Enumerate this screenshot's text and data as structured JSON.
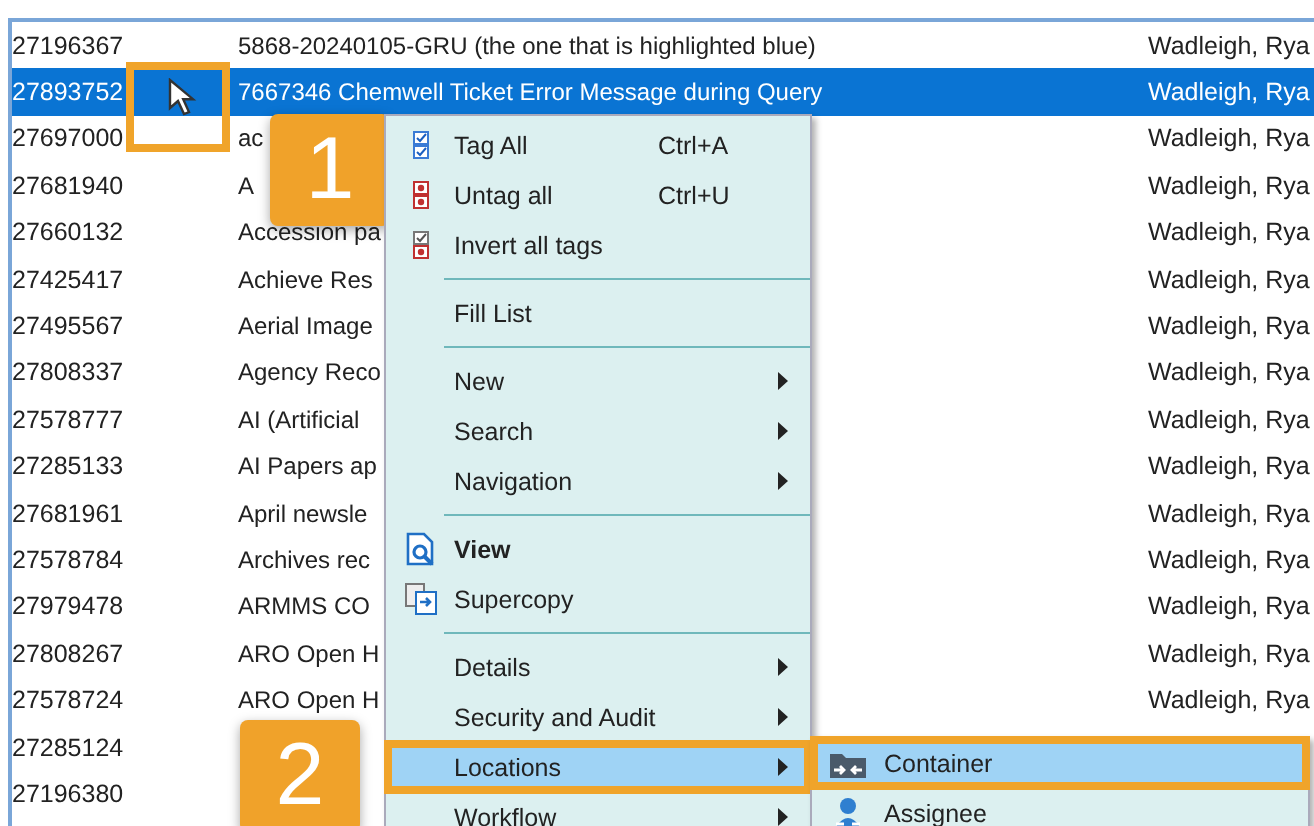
{
  "list": {
    "rows": [
      {
        "id": "27196367",
        "title": "5868-20240105-GRU (the one that is highlighted blue)",
        "owner": "Wadleigh, Rya",
        "selected": false
      },
      {
        "id": "27893752",
        "title": "7667346 Chemwell Ticket Error Message during Query",
        "owner": "Wadleigh, Rya",
        "selected": true
      },
      {
        "id": "27697000",
        "title": "ac",
        "owner": "Wadleigh, Rya",
        "selected": false
      },
      {
        "id": "27681940",
        "title": "A",
        "owner": "Wadleigh, Rya",
        "selected": false
      },
      {
        "id": "27660132",
        "title": "Accession pa",
        "owner": "Wadleigh, Rya",
        "selected": false
      },
      {
        "id": "27425417",
        "title": "Achieve Res",
        "owner": "Wadleigh, Rya",
        "selected": false
      },
      {
        "id": "27495567",
        "title": "Aerial Image",
        "owner": "Wadleigh, Rya",
        "selected": false
      },
      {
        "id": "27808337",
        "title": "Agency Reco",
        "owner": "Wadleigh, Rya",
        "selected": false
      },
      {
        "id": "27578777",
        "title": "AI (Artificial",
        "owner": "Wadleigh, Rya",
        "selected": false
      },
      {
        "id": "27285133",
        "title": "AI Papers ap",
        "owner": "Wadleigh, Rya",
        "selected": false
      },
      {
        "id": "27681961",
        "title": "April newsle",
        "owner": "Wadleigh, Rya",
        "selected": false
      },
      {
        "id": "27578784",
        "title": "Archives rec",
        "owner": "Wadleigh, Rya",
        "selected": false
      },
      {
        "id": "27979478",
        "title": "ARMMS CO",
        "owner": "Wadleigh, Rya",
        "selected": false
      },
      {
        "id": "27808267",
        "title": "ARO Open H",
        "owner": "Wadleigh, Rya",
        "selected": false
      },
      {
        "id": "27578724",
        "title": "ARO Open H",
        "owner": "Wadleigh, Rya",
        "selected": false
      },
      {
        "id": "27285124",
        "selected": false
      },
      {
        "id": "27196380",
        "selected": false
      }
    ]
  },
  "step_badges": [
    {
      "label": "1"
    },
    {
      "label": "2"
    }
  ],
  "context_menu": {
    "items": [
      {
        "kind": "item",
        "label": "Tag All",
        "shortcut": "Ctrl+A"
      },
      {
        "kind": "item",
        "label": "Untag all",
        "shortcut": "Ctrl+U"
      },
      {
        "kind": "item",
        "label": "Invert all tags"
      },
      {
        "kind": "separator"
      },
      {
        "kind": "item",
        "label": "Fill List"
      },
      {
        "kind": "separator"
      },
      {
        "kind": "item",
        "label": "New",
        "submenu": true
      },
      {
        "kind": "item",
        "label": "Search",
        "submenu": true
      },
      {
        "kind": "item",
        "label": "Navigation",
        "submenu": true
      },
      {
        "kind": "separator"
      },
      {
        "kind": "item",
        "label": "View",
        "bold": true
      },
      {
        "kind": "item",
        "label": "Supercopy"
      },
      {
        "kind": "separator"
      },
      {
        "kind": "item",
        "label": "Details",
        "submenu": true
      },
      {
        "kind": "item",
        "label": "Security and Audit",
        "submenu": true
      },
      {
        "kind": "item",
        "label": "Locations",
        "submenu": true,
        "selected": true,
        "annotated": true
      },
      {
        "kind": "item",
        "label": "Workflow",
        "submenu": true
      }
    ]
  },
  "submenu": {
    "items": [
      {
        "label": "Container",
        "selected": true,
        "annotated": true
      },
      {
        "label": "Assignee",
        "selected": false,
        "annotated": false
      }
    ]
  }
}
